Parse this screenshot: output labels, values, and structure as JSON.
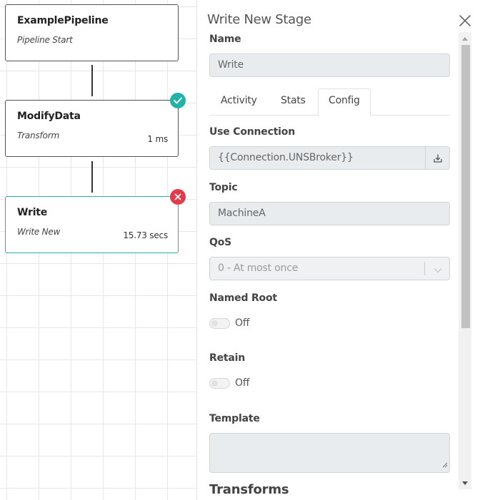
{
  "pipeline": {
    "nodes": [
      {
        "title": "ExamplePipeline",
        "subtitle": "Pipeline Start",
        "time": "",
        "status": "none"
      },
      {
        "title": "ModifyData",
        "subtitle": "Transform",
        "time": "1 ms",
        "status": "success"
      },
      {
        "title": "Write",
        "subtitle": "Write New",
        "time": "15.73 secs",
        "status": "error"
      }
    ]
  },
  "panel": {
    "title": "Write New Stage",
    "name_label": "Name",
    "name_value": "Write",
    "tabs": [
      {
        "label": "Activity",
        "active": false
      },
      {
        "label": "Stats",
        "active": false
      },
      {
        "label": "Config",
        "active": true
      }
    ],
    "use_connection_label": "Use Connection",
    "use_connection_value": "{{Connection.UNSBroker}}",
    "topic_label": "Topic",
    "topic_value": "MachineA",
    "qos_label": "QoS",
    "qos_value": "0 - At most once",
    "named_root_label": "Named Root",
    "named_root_state": "Off",
    "retain_label": "Retain",
    "retain_state": "Off",
    "template_label": "Template",
    "template_value": "",
    "next_section_label": "Transforms"
  },
  "colors": {
    "success": "#20b3a9",
    "error": "#e23b4b",
    "active_border": "#22b2a8"
  },
  "icons": {
    "close": "close-icon",
    "success": "checkmark-icon",
    "error": "x-icon",
    "connection_picker": "download-icon",
    "select": "chevron-down-icon"
  }
}
